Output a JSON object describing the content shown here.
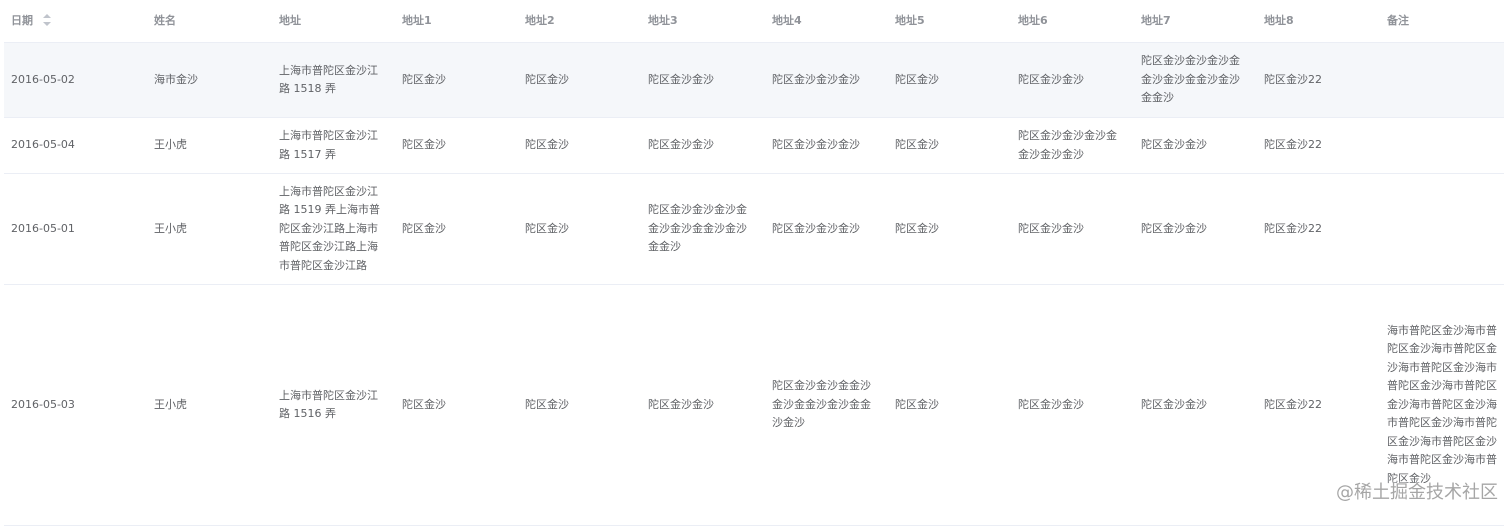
{
  "table": {
    "headers": [
      "日期",
      "姓名",
      "地址",
      "地址1",
      "地址2",
      "地址3",
      "地址4",
      "地址5",
      "地址6",
      "地址7",
      "地址8",
      "备注"
    ],
    "rows": [
      {
        "date": "2016-05-02",
        "name": "海市金沙",
        "address": "上海市普陀区金沙江路 1518 弄",
        "addr1": "陀区金沙",
        "addr2": "陀区金沙",
        "addr3": "陀区金沙金沙",
        "addr4": "陀区金沙金沙金沙",
        "addr5": "陀区金沙",
        "addr6": "陀区金沙金沙",
        "addr7": "陀区金沙金沙金沙金金沙金沙金金沙金沙金金沙",
        "addr8": "陀区金沙22",
        "remark": ""
      },
      {
        "date": "2016-05-04",
        "name": "王小虎",
        "address": "上海市普陀区金沙江路 1517 弄",
        "addr1": "陀区金沙",
        "addr2": "陀区金沙",
        "addr3": "陀区金沙金沙",
        "addr4": "陀区金沙金沙金沙",
        "addr5": "陀区金沙",
        "addr6": "陀区金沙金沙金沙金金沙金沙金沙",
        "addr7": "陀区金沙金沙",
        "addr8": "陀区金沙22",
        "remark": ""
      },
      {
        "date": "2016-05-01",
        "name": "王小虎",
        "address": "上海市普陀区金沙江路 1519 弄上海市普陀区金沙江路上海市普陀区金沙江路上海市普陀区金沙江路",
        "addr1": "陀区金沙",
        "addr2": "陀区金沙",
        "addr3": "陀区金沙金沙金沙金金沙金沙金金沙金沙金金沙",
        "addr4": "陀区金沙金沙金沙",
        "addr5": "陀区金沙",
        "addr6": "陀区金沙金沙",
        "addr7": "陀区金沙金沙",
        "addr8": "陀区金沙22",
        "remark": ""
      },
      {
        "date": "2016-05-03",
        "name": "王小虎",
        "address": "上海市普陀区金沙江路 1516 弄",
        "addr1": "陀区金沙",
        "addr2": "陀区金沙",
        "addr3": "陀区金沙金沙",
        "addr4": "陀区金沙金沙金金沙金沙金金沙金沙金金沙金沙",
        "addr5": "陀区金沙",
        "addr6": "陀区金沙金沙",
        "addr7": "陀区金沙金沙",
        "addr8": "陀区金沙22",
        "remark": "海市普陀区金沙海市普陀区金沙海市普陀区金沙海市普陀区金沙海市普陀区金沙海市普陀区金沙海市普陀区金沙海市普陀区金沙海市普陀区金沙海市普陀区金沙海市普陀区金沙海市普陀区金沙"
      }
    ]
  },
  "watermark": "@稀土掘金技术社区",
  "icons": {
    "sort": "sort-caret-icon"
  },
  "colors": {
    "header_text": "#909399",
    "body_text": "#606266",
    "border": "#ebeef5",
    "hover_row": "#f5f7fa"
  }
}
